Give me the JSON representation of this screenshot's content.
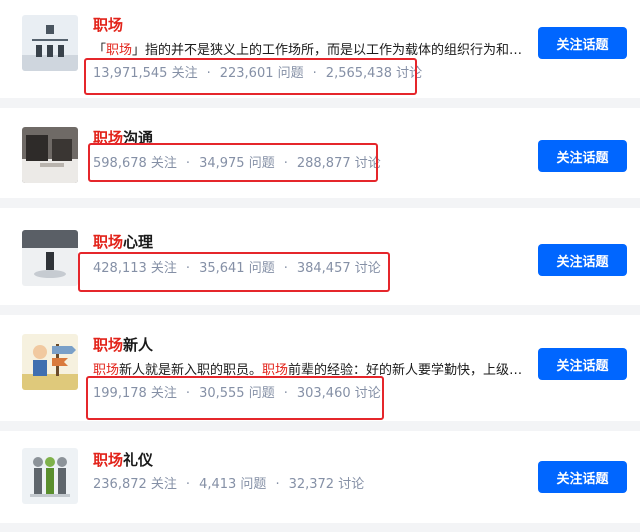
{
  "topics": [
    {
      "title_hl": "职场",
      "title_rest": "",
      "desc": [
        {
          "t": "「",
          "hl": false
        },
        {
          "t": "职场",
          "hl": true
        },
        {
          "t": "」指的并不是狭义上的工作场所，而是以工作为载体的组织行为和人…",
          "hl": false
        }
      ],
      "followers": "13,971,545",
      "follow_unit": "关注",
      "questions": "223,601",
      "question_unit": "问题",
      "discussions": "2,565,438",
      "discussion_unit": "讨论",
      "button": "关注话题"
    },
    {
      "title_hl": "职场",
      "title_rest": "沟通",
      "desc": [],
      "followers": "598,678",
      "follow_unit": "关注",
      "questions": "34,975",
      "question_unit": "问题",
      "discussions": "288,877",
      "discussion_unit": "讨论",
      "button": "关注话题"
    },
    {
      "title_hl": "职场",
      "title_rest": "心理",
      "desc": [],
      "followers": "428,113",
      "follow_unit": "关注",
      "questions": "35,641",
      "question_unit": "问题",
      "discussions": "384,457",
      "discussion_unit": "讨论",
      "button": "关注话题"
    },
    {
      "title_hl": "职场",
      "title_rest": "新人",
      "desc": [
        {
          "t": "职场",
          "hl": true
        },
        {
          "t": "新人就是新入职的职员。",
          "hl": false
        },
        {
          "t": "职场",
          "hl": true
        },
        {
          "t": "前辈的经验：好的新人要学勤快，上级交…",
          "hl": false
        }
      ],
      "followers": "199,178",
      "follow_unit": "关注",
      "questions": "30,555",
      "question_unit": "问题",
      "discussions": "303,460",
      "discussion_unit": "讨论",
      "button": "关注话题"
    },
    {
      "title_hl": "职场",
      "title_rest": "礼仪",
      "desc": [],
      "followers": "236,872",
      "follow_unit": "关注",
      "questions": "4,413",
      "question_unit": "问题",
      "discussions": "32,372",
      "discussion_unit": "讨论",
      "button": "关注话题"
    }
  ],
  "colors": {
    "highlight": "#e2231a",
    "button": "#0066ff",
    "meta": "#8590a6",
    "annotation_box": "#e5262b"
  }
}
